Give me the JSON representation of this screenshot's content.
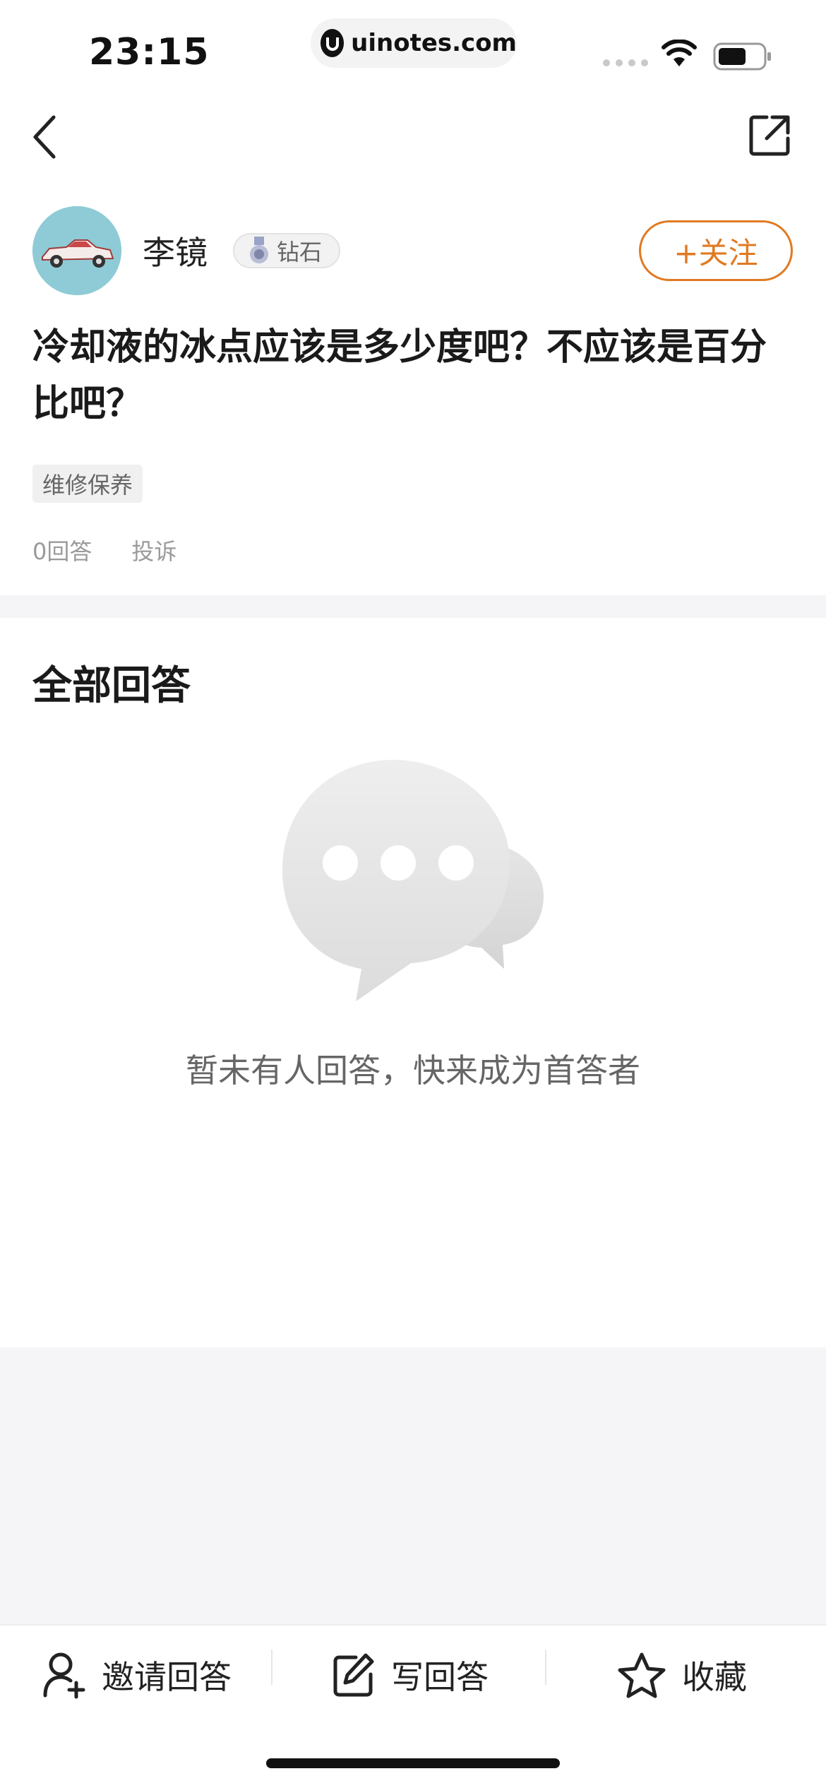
{
  "status_bar": {
    "time": "23:15",
    "url": "uinotes.com"
  },
  "nav": {
    "back_icon": "chevron-left-icon",
    "share_icon": "external-link-icon"
  },
  "author": {
    "name": "李镜",
    "badge": "钻石",
    "follow_label": "+关注"
  },
  "question": {
    "title": "冷却液的冰点应该是多少度吧？不应该是百分比吧？",
    "tag": "维修保养",
    "answer_count": "0回答",
    "report": "投诉"
  },
  "answers_section": {
    "title": "全部回答",
    "empty_text": "暂未有人回答，快来成为首答者"
  },
  "bottom_bar": {
    "invite": "邀请回答",
    "write": "写回答",
    "favorite": "收藏"
  },
  "colors": {
    "accent": "#e07a22",
    "band": "#f5f5f7"
  }
}
